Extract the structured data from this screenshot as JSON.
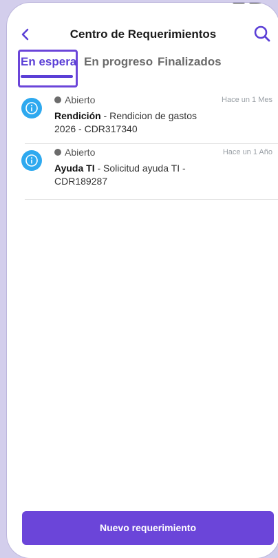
{
  "header": {
    "title": "Centro de Requerimientos",
    "back_icon": "chevron-left-icon",
    "search_icon": "search-icon"
  },
  "tabs": [
    {
      "label": "En espera",
      "active": true
    },
    {
      "label": "En progreso",
      "active": false
    },
    {
      "label": "Finalizados",
      "active": false
    }
  ],
  "requests": [
    {
      "status": "Abierto",
      "time": "Hace un 1 Mes",
      "category": "Rendición",
      "description": " - Rendicion de gastos 2026 - CDR317340"
    },
    {
      "status": "Abierto",
      "time": "Hace un 1 Año",
      "category": "Ayuda TI",
      "description": " - Solicitud ayuda TI - CDR189287"
    }
  ],
  "new_request_button": "Nuevo requerimiento",
  "colors": {
    "accent": "#6b45d9",
    "info": "#2ea9ef",
    "background": "#d3ceec"
  }
}
